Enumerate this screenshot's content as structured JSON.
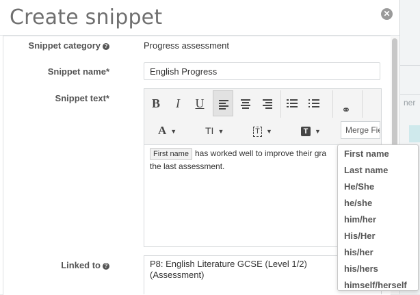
{
  "dialog": {
    "title": "Create snippet"
  },
  "form": {
    "category_label": "Snippet category",
    "category_value": "Progress assessment",
    "name_label": "Snippet name*",
    "name_value": "English Progress",
    "text_label": "Snippet text*",
    "linked_label": "Linked to",
    "linked_value_line1": "P8: English Literature GCSE (Level 1/2)",
    "linked_value_line2": "(Assessment)"
  },
  "editor": {
    "toolbar": {
      "bold": "B",
      "italic": "I",
      "underline": "U",
      "font_glyph": "A",
      "text_size_glyph": "TI",
      "merge_field_placeholder": "Merge Fie"
    },
    "content": {
      "merge_tag": "First name",
      "text_line1": "has worked well to improve their gra",
      "text_line2": "the last assessment."
    }
  },
  "merge_dropdown": {
    "items": [
      "First name",
      "Last name",
      "He/She",
      "he/she",
      "him/her",
      "His/Her",
      "his/her",
      "his/hers",
      "himself/herself"
    ]
  },
  "background": {
    "partial_text": "ner"
  }
}
